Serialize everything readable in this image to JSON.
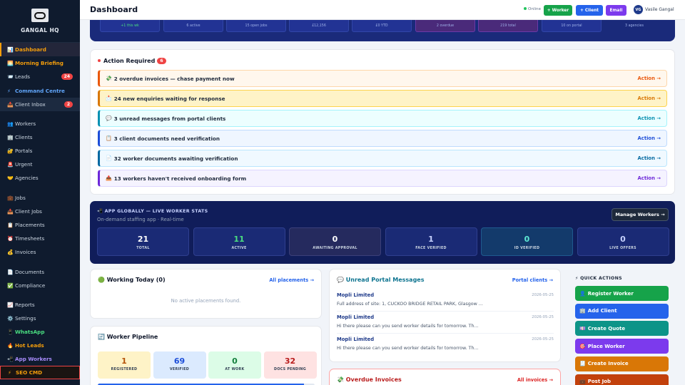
{
  "brand": {
    "logo_text": "GANGAL",
    "name": "GANGAL HQ"
  },
  "sidebar": {
    "items": [
      {
        "icon": "📊",
        "label": "Dashboard"
      },
      {
        "icon": "🌅",
        "label": "Morning Briefing"
      },
      {
        "icon": "📨",
        "label": "Leads",
        "badge": "24"
      },
      {
        "icon": "⚡",
        "label": "Command Centre"
      },
      {
        "icon": "📥",
        "label": "Client Inbox",
        "badge": "2"
      },
      {
        "icon": "👥",
        "label": "Workers"
      },
      {
        "icon": "🏢",
        "label": "Clients"
      },
      {
        "icon": "🔐",
        "label": "Portals"
      },
      {
        "icon": "🚨",
        "label": "Urgent"
      },
      {
        "icon": "🤝",
        "label": "Agencies"
      },
      {
        "icon": "💼",
        "label": "Jobs"
      },
      {
        "icon": "📥",
        "label": "Client Jobs"
      },
      {
        "icon": "📋",
        "label": "Placements"
      },
      {
        "icon": "⏰",
        "label": "Timesheets"
      },
      {
        "icon": "💰",
        "label": "Invoices"
      },
      {
        "icon": "📄",
        "label": "Documents"
      },
      {
        "icon": "✅",
        "label": "Compliance"
      },
      {
        "icon": "📈",
        "label": "Reports"
      },
      {
        "icon": "⚙️",
        "label": "Settings"
      },
      {
        "icon": "📱",
        "label": "WhatsApp"
      },
      {
        "icon": "🔥",
        "label": "Hot Leads"
      },
      {
        "icon": "📲",
        "label": "App Workers"
      },
      {
        "icon": "⚡",
        "label": "SEO CMD"
      }
    ]
  },
  "header": {
    "title": "Dashboard",
    "status": "Online",
    "buttons": {
      "worker": "+ Worker",
      "client": "+ Client",
      "email": "Email"
    },
    "user": {
      "initials": "VG",
      "name": "Vasile Gangal"
    }
  },
  "hero_stats": [
    "+1 this wk",
    "6 active",
    "15 open jobs",
    "£12,156",
    "£0 YTD",
    "2 overdue",
    "219 total",
    "10 on portal",
    "3 agencies"
  ],
  "action_required": {
    "title": "Action Required",
    "count": "6",
    "action_label": "Action →",
    "items": [
      {
        "icon": "💸",
        "text": "2 overdue invoices — chase payment now",
        "color": "#ea580c"
      },
      {
        "icon": "📩",
        "text": "24 new enquiries waiting for response",
        "color": "#d97706"
      },
      {
        "icon": "💬",
        "text": "3 unread messages from portal clients",
        "color": "#0891b2"
      },
      {
        "icon": "📋",
        "text": "3 client documents need verification",
        "color": "#1d4ed8"
      },
      {
        "icon": "📄",
        "text": "32 worker documents awaiting verification",
        "color": "#0369a1"
      },
      {
        "icon": "📤",
        "text": "13 workers haven't received onboarding form",
        "color": "#6d28d9"
      }
    ]
  },
  "app_stats": {
    "title": "📲 APP GLOBALLY — LIVE WORKER STATS",
    "subtitle": "On-demand staffing app · Real-time",
    "manage_button": "Manage Workers →",
    "stats": [
      {
        "value": "21",
        "label": "TOTAL",
        "color": "#ffffff"
      },
      {
        "value": "11",
        "label": "ACTIVE",
        "color": "#4ade80"
      },
      {
        "value": "0",
        "label": "AWAITING APPROVAL",
        "color": "#ffffff"
      },
      {
        "value": "1",
        "label": "FACE VERIFIED",
        "color": "#c7d2fe"
      },
      {
        "value": "0",
        "label": "ID VERIFIED",
        "color": "#5eead4"
      },
      {
        "value": "0",
        "label": "LIVE OFFERS",
        "color": "#c7d2fe"
      }
    ]
  },
  "working_today": {
    "title": "🟢 Working Today (0)",
    "link": "All placements →",
    "empty": "No active placements found."
  },
  "pipeline": {
    "title": "🔄 Worker Pipeline",
    "progress": 0.95,
    "stats": [
      {
        "value": "1",
        "label": "REGISTERED",
        "bg": "#fef3c7",
        "color": "#b45309"
      },
      {
        "value": "69",
        "label": "VERIFIED",
        "bg": "#dbeafe",
        "color": "#1d4ed8"
      },
      {
        "value": "0",
        "label": "AT WORK",
        "bg": "#dcfce7",
        "color": "#15803d"
      },
      {
        "value": "32",
        "label": "DOCS PENDING",
        "bg": "#fee2e2",
        "color": "#b91c1c"
      }
    ]
  },
  "portal_messages": {
    "title": "💬 Unread Portal Messages",
    "link": "Portal clients →",
    "items": [
      {
        "from": "Mopli Limited",
        "date": "2026-05-25",
        "text": "Full address of site: 1, CUCKOO BRIDGE RETAIL PARK, Glasgow ..."
      },
      {
        "from": "Mopli Limited",
        "date": "2026-05-25",
        "text": "Hi there please can you send worker details for tomorrow. Th..."
      },
      {
        "from": "Mopli Limited",
        "date": "2026-05-25",
        "text": "Hi there please can you send worker details for tomorrow. Th..."
      }
    ]
  },
  "overdue": {
    "title": "💸 Overdue Invoices",
    "link": "All invoices →"
  },
  "quick_actions": {
    "title": "⚡ QUICK ACTIONS",
    "items": [
      {
        "icon": "👤",
        "label": "Register Worker",
        "color": "#16a34a"
      },
      {
        "icon": "🏢",
        "label": "Add Client",
        "color": "#2563eb"
      },
      {
        "icon": "💷",
        "label": "Create Quote",
        "color": "#0d9488"
      },
      {
        "icon": "🎯",
        "label": "Place Worker",
        "color": "#7c3aed"
      },
      {
        "icon": "🧾",
        "label": "Create Invoice",
        "color": "#d97706"
      },
      {
        "icon": "💼",
        "label": "Post Job",
        "color": "#c2410c"
      }
    ]
  }
}
